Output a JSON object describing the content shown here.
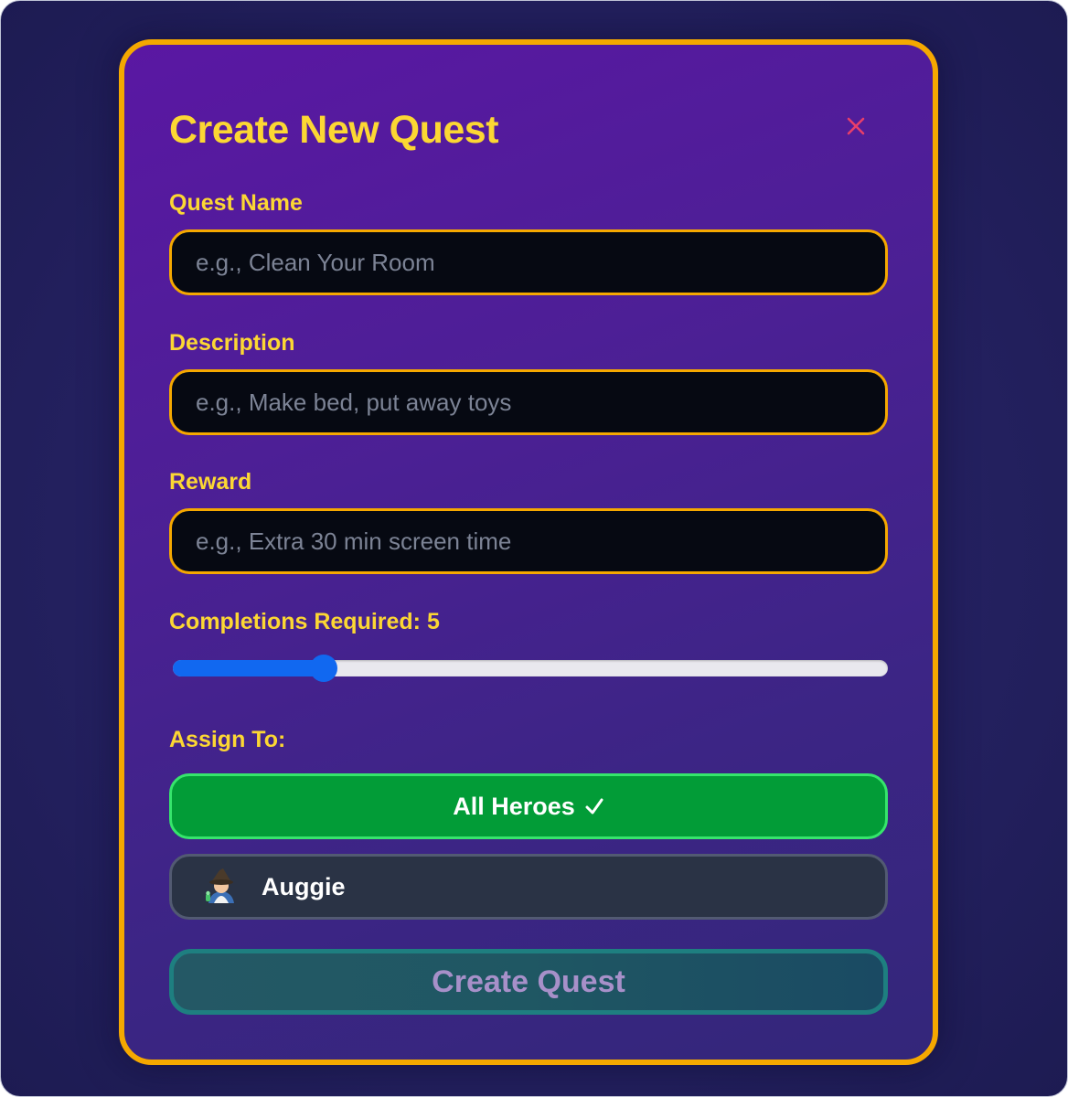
{
  "modal": {
    "title": "Create New Quest",
    "close_icon": "close-icon"
  },
  "form": {
    "quest_name": {
      "label": "Quest Name",
      "value": "",
      "placeholder": "e.g., Clean Your Room"
    },
    "description": {
      "label": "Description",
      "value": "",
      "placeholder": "e.g., Make bed, put away toys"
    },
    "reward": {
      "label": "Reward",
      "value": "",
      "placeholder": "e.g., Extra 30 min screen time"
    },
    "completions": {
      "label": "Completions Required: 5",
      "value": 5,
      "min": 1,
      "max": 20
    }
  },
  "assign": {
    "label": "Assign To:",
    "all_heroes": {
      "label": "All Heroes",
      "selected": true,
      "icon": "checkmark-icon"
    },
    "heroes": [
      {
        "name": "Auggie",
        "avatar_icon": "wizard-avatar-icon",
        "selected": false
      }
    ]
  },
  "submit": {
    "label": "Create Quest",
    "enabled": false
  },
  "colors": {
    "accent_yellow": "#fcd733",
    "border_orange": "#f5a800",
    "selected_green": "#029c37",
    "slider_blue": "#1168f0",
    "modal_purple": "#5a17a3"
  }
}
